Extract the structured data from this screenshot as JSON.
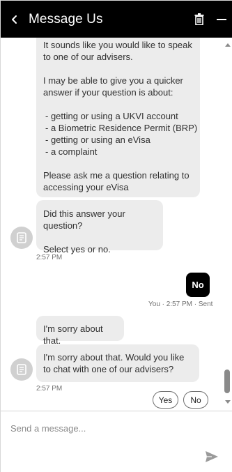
{
  "header": {
    "title": "Message Us",
    "back_icon": "chevron-left-icon",
    "delete_icon": "trash-icon",
    "minimize_icon": "minimize-icon",
    "background_color": "#000000"
  },
  "messages": [
    {
      "from": "agent",
      "paragraphs": [
        "It sounds like you would like to speak to one of our advisers.",
        "I may be able to give you a quicker answer if your question is about:",
        "- getting or using a UKVI account\n- a Biometric Residence Permit (BRP)\n- getting or using an eVisa\n- a complaint",
        "Please ask me a question relating to accessing your eVisa"
      ]
    },
    {
      "from": "agent",
      "paragraphs": [
        "Did this answer your question?",
        "Select yes or no."
      ],
      "time": "2:57 PM"
    },
    {
      "from": "user",
      "text": "No",
      "meta": "You · 2:57 PM · Sent"
    },
    {
      "from": "agent",
      "paragraphs": [
        "I'm sorry about that."
      ]
    },
    {
      "from": "agent",
      "paragraphs": [
        "I'm sorry about that. Would you like to chat with one of our advisers?"
      ],
      "time": "2:57 PM"
    }
  ],
  "quick_replies": [
    "Yes",
    "No"
  ],
  "composer": {
    "placeholder": "Send a message...",
    "send_icon": "send-icon"
  },
  "colors": {
    "agent_bubble": "#ececec",
    "user_bubble": "#000000",
    "avatar": "#d0d0d0"
  }
}
